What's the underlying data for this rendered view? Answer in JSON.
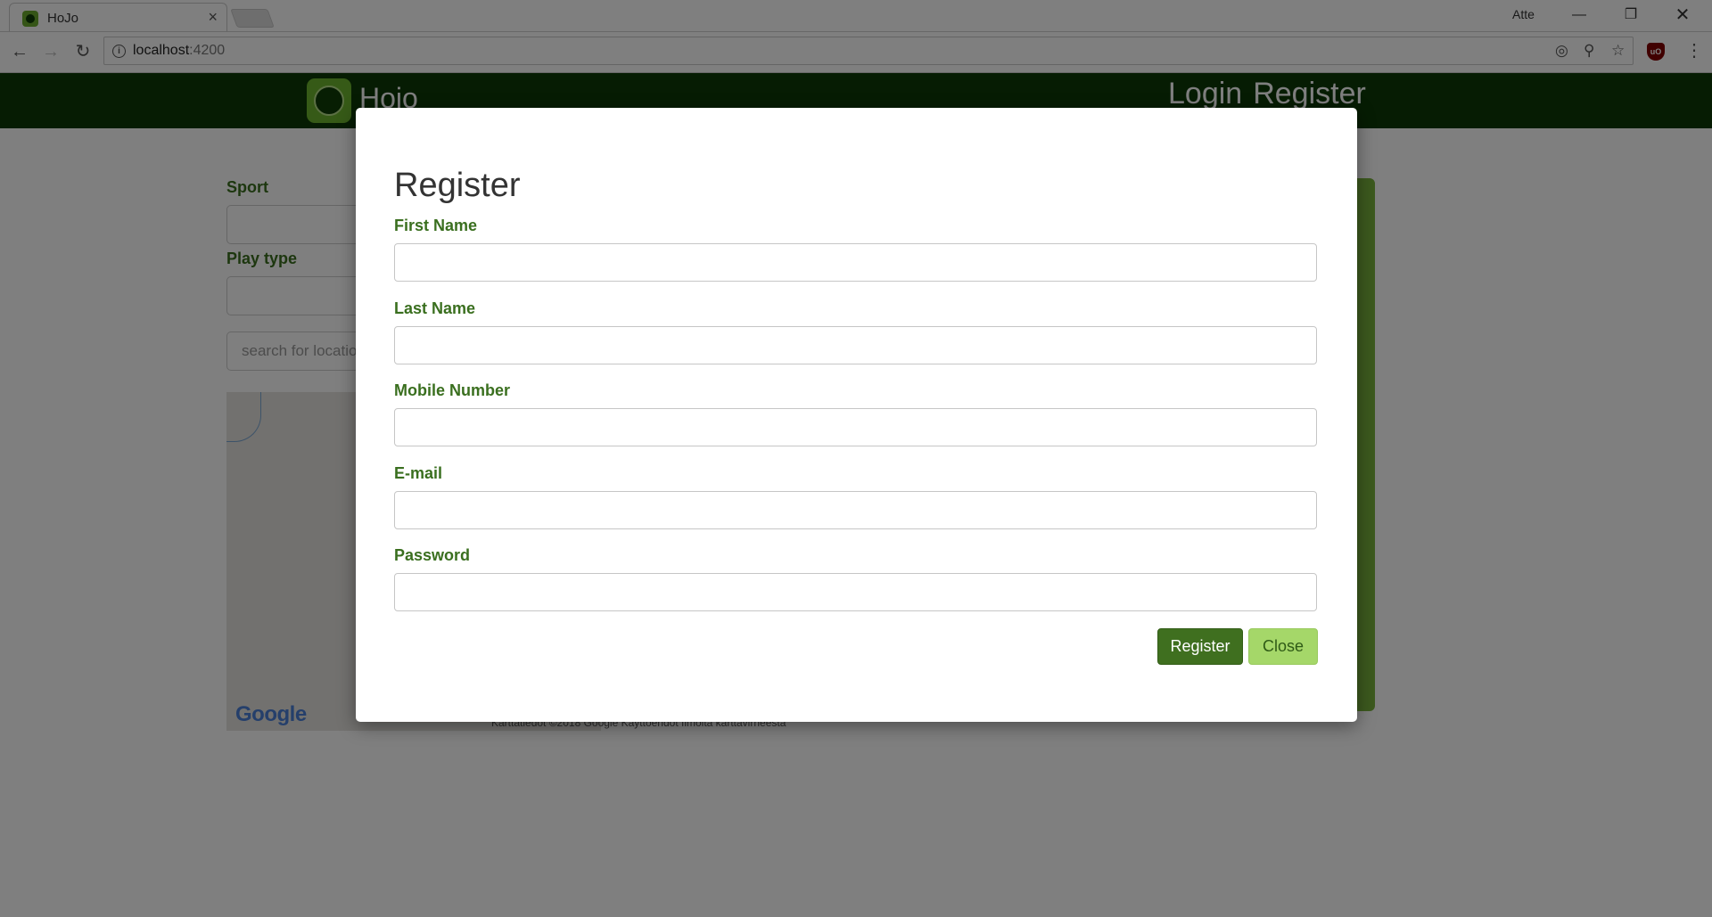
{
  "browser": {
    "tab_title": "HoJo",
    "tab_close": "×",
    "profile_name": "Atte",
    "url_host": "localhost",
    "url_port": ":4200",
    "icons": [
      "back-arrow-icon",
      "forward-arrow-icon",
      "reload-icon",
      "info-icon",
      "location-icon",
      "key-icon",
      "star-icon",
      "ublock-icon",
      "menu-icon"
    ]
  },
  "header": {
    "brand": "Hojo",
    "nav_login": "Login",
    "nav_register": "Register",
    "brand_color": "#0c3806"
  },
  "filters": {
    "sport_label": "Sport",
    "playtype_label": "Play type",
    "search_placeholder": "search for locatio"
  },
  "map": {
    "logo": "Google",
    "attribution": "Karttatiedot ©2018 Google    Käyttöehdot    Ilmoita karttavirheestä"
  },
  "modal": {
    "title": "Register",
    "fields": [
      {
        "label": "First Name",
        "value": ""
      },
      {
        "label": "Last Name",
        "value": ""
      },
      {
        "label": "Mobile Number",
        "value": ""
      },
      {
        "label": "E-mail",
        "value": ""
      },
      {
        "label": "Password",
        "value": ""
      }
    ],
    "register_button": "Register",
    "close_button": "Close",
    "accent_color": "#3f6f1f",
    "secondary_color": "#a5d769"
  }
}
